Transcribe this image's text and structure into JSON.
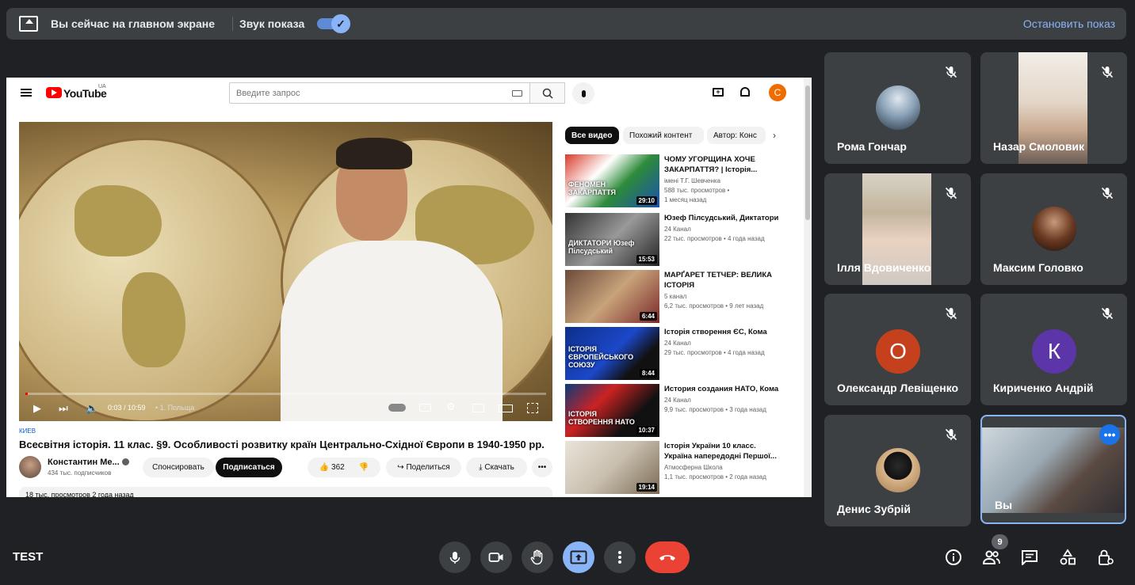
{
  "banner": {
    "status_text": "Вы сейчас на главном экране",
    "sound_label": "Звук показа",
    "sound_toggle": "on",
    "stop_button": "Остановить показ"
  },
  "youtube": {
    "logo_text": "YouTube",
    "country": "UA",
    "search_placeholder": "Введите запрос",
    "avatar_letter": "C",
    "player": {
      "time": "0:03 / 10:59",
      "chapter": "• 1. Польща",
      "progress_fraction": 0.005
    },
    "video": {
      "channel_tag": "КИЕВ",
      "title": "Всесвітня історія. 11 клас. §9. Особливості розвитку країн Центрально-Східної Європи в 1940-1950 рр.",
      "channel_name": "Константин Ме...",
      "subscribers": "434 тыс. подписчиков",
      "sponsor_label": "Спонсировать",
      "subscribe_label": "Подписаться",
      "likes": "362",
      "share_label": "Поделиться",
      "download_label": "Скачать",
      "more_label": "•••",
      "description_peek": "18 тыс. просмотров  2 года назад"
    },
    "chips": [
      "Все видео",
      "Похожий контент",
      "Автор: Конс"
    ],
    "recommendations": [
      {
        "title": "ЧОМУ УГОРЩИНА ХОЧЕ ЗАКАРПАТТЯ? | Історія...",
        "channel": "імені Т.Г. Шевченка",
        "views": "588 тыс. просмотров •",
        "age": "1 месяц назад",
        "duration": "29:10",
        "thumb_text": "ФЕНОМЕН ЗАКАРПАТТЯ"
      },
      {
        "title": "Юзеф Пілсудський, Диктатори",
        "channel": "24 Канал",
        "views": "22 тыс. просмотров • 4 года назад",
        "age": "",
        "duration": "15:53",
        "thumb_text": "ДИКТАТОРИ Юзеф Пілсудський"
      },
      {
        "title": "МАРҐАРЕТ ТЕТЧЕР: ВЕЛИКА ІСТОРІЯ",
        "channel": "5 канал",
        "views": "6,2 тыс. просмотров • 9 лет назад",
        "age": "",
        "duration": "6:44",
        "thumb_text": ""
      },
      {
        "title": "Історія створення ЄС, Кома",
        "channel": "24 Канал",
        "views": "29 тыс. просмотров • 4 года назад",
        "age": "",
        "duration": "8:44",
        "thumb_text": "ІСТОРІЯ ЄВРОПЕЙСЬКОГО СОЮЗУ"
      },
      {
        "title": "История создания НАТО, Кома",
        "channel": "24 Канал",
        "views": "9,9 тыс. просмотров • 3 года назад",
        "age": "",
        "duration": "10:37",
        "thumb_text": "ІСТОРІЯ СТВОРЕННЯ НАТО"
      },
      {
        "title": "Історія України 10 класс. Україна напередодні Першої...",
        "channel": "Атмосферна Школа",
        "views": "1,1 тыс. просмотров • 2 года назад",
        "age": "",
        "duration": "19:14",
        "thumb_text": ""
      }
    ]
  },
  "participants": [
    {
      "name": "Рома Гончар",
      "type": "photo",
      "muted": true
    },
    {
      "name": "Назар Смоловик",
      "type": "video",
      "muted": true
    },
    {
      "name": "Ілля Вдовиченко",
      "type": "video",
      "muted": true
    },
    {
      "name": "Максим Головко",
      "type": "photo",
      "muted": true
    },
    {
      "name": "Олександр Левіщенко",
      "type": "initial",
      "initial": "О",
      "color": "#c5401d",
      "muted": true
    },
    {
      "name": "Кириченко Андрій",
      "type": "initial",
      "initial": "К",
      "color": "#5c35a8",
      "muted": true
    },
    {
      "name": "Денис Зубрій",
      "type": "photo",
      "muted": true
    },
    {
      "name": "Вы",
      "type": "video",
      "muted": false
    }
  ],
  "toolbar": {
    "meeting_name": "TEST",
    "participant_count": "9"
  },
  "colors": {
    "background": "#202124",
    "tile": "#3c4043",
    "accent": "#8ab4f8",
    "end_call": "#ea4335"
  }
}
